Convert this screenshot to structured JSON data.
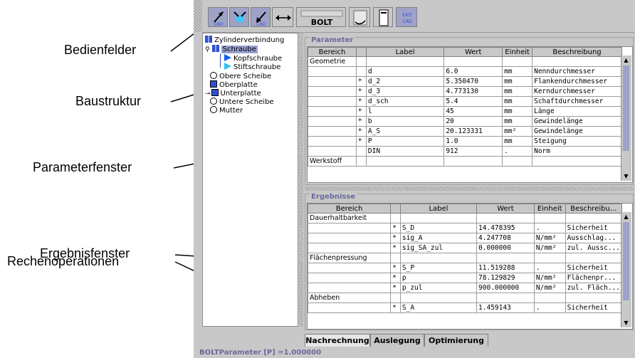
{
  "callouts": {
    "bedienfelder": "Bedienfelder",
    "baustruktur": "Baustruktur",
    "parameterfenster": "Parameterfenster",
    "ergebnisfenster": "Ergebnisfenster",
    "rechenoperationen": "Rechenoperationen"
  },
  "toolbar": {
    "bolt_label": "BOLT"
  },
  "tree": [
    {
      "label": "Zylinderverbindung",
      "icon": "assembly-icon"
    },
    {
      "label": "Schraube",
      "icon": "assembly-icon",
      "selected": true
    },
    {
      "label": "Kopfschraube",
      "icon": "bookmark-icon"
    },
    {
      "label": "Stiftschraube",
      "icon": "bookmark-icon"
    },
    {
      "label": "Obere Scheibe",
      "icon": "washer-icon"
    },
    {
      "label": "Oberplatte",
      "icon": "plate-icon"
    },
    {
      "label": "Unterplatte",
      "icon": "plate-icon"
    },
    {
      "label": "Untere Scheibe",
      "icon": "washer-icon"
    },
    {
      "label": "Mutter",
      "icon": "washer-icon"
    }
  ],
  "parameter": {
    "title": "Parameter",
    "headers": [
      "Bereich",
      "",
      "Label",
      "Wert",
      "Einheit",
      "Beschreibung"
    ],
    "rows": [
      [
        "Geometrie",
        "",
        "",
        "",
        "",
        ""
      ],
      [
        "",
        "",
        "d",
        "6.0",
        "mm",
        "Nenndurchmesser"
      ],
      [
        "",
        "*",
        "d_2",
        "5.350470",
        "mm",
        "Flankendurchmesser"
      ],
      [
        "",
        "*",
        "d_3",
        "4.773130",
        "mm",
        "Kerndurchmesser"
      ],
      [
        "",
        "*",
        "d_sch",
        "5.4",
        "mm",
        "Schaftdurchmesser"
      ],
      [
        "",
        "*",
        "l",
        "45",
        "mm",
        "Länge"
      ],
      [
        "",
        "*",
        "b",
        "20",
        "mm",
        "Gewindelänge"
      ],
      [
        "",
        "*",
        "A_S",
        "20.123331",
        "mm²",
        "Gewindelänge"
      ],
      [
        "",
        "*",
        "P",
        "1.0",
        "mm",
        "Steigung"
      ],
      [
        "",
        "",
        "DIN",
        "912",
        ".",
        "Norm"
      ],
      [
        "Werkstoff",
        "",
        "",
        "",
        "",
        ""
      ]
    ]
  },
  "ergebnisse": {
    "title": "Ergebnisse",
    "headers": [
      "Bereich",
      "",
      "Label",
      "Wert",
      "Einheit",
      "Beschreibu..."
    ],
    "rows": [
      [
        "Dauerhaltbarkeit",
        "",
        "",
        "",
        "",
        ""
      ],
      [
        "",
        "*",
        "S_D",
        "14.478395",
        ".",
        "Sicherheit"
      ],
      [
        "",
        "*",
        "sig_A",
        "4.247708",
        "N/mm²",
        "Ausschlag..."
      ],
      [
        "",
        "*",
        "sig_SA_zul",
        "0.000000",
        "N/mm²",
        "zul. Aussc..."
      ],
      [
        "Flächenpressung",
        "",
        "",
        "",
        "",
        ""
      ],
      [
        "",
        "*",
        "S_P",
        "11.519288",
        ".",
        "Sicherheit"
      ],
      [
        "",
        "*",
        "p",
        "78.129829",
        "N/mm²",
        "Flächenpr..."
      ],
      [
        "",
        "*",
        "p_zul",
        "900.000000",
        "N/mm²",
        "zul. Fläch..."
      ],
      [
        "Abheben",
        "",
        "",
        "",
        "",
        ""
      ],
      [
        "",
        "*",
        "S_A",
        "1.459143",
        ".",
        "Sicherheit"
      ]
    ]
  },
  "tabs": [
    "Nachrechnung",
    "Auslegung",
    "Optimierung"
  ],
  "status": "BOLTParameter [P] =1.000000"
}
